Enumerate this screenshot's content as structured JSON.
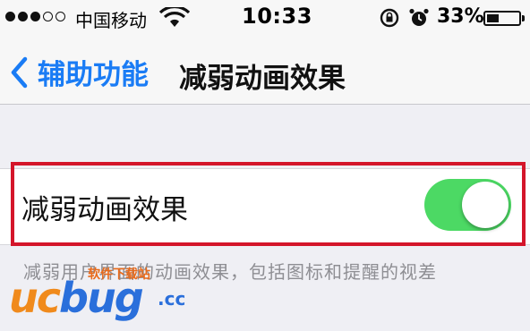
{
  "status_bar": {
    "carrier": "中国移动",
    "time": "10:33",
    "battery_percent": "33%",
    "battery_level": 0.33,
    "signal_bars_filled": 3,
    "signal_bars_total": 5
  },
  "nav": {
    "back_label": "辅助功能",
    "title": "减弱动画效果",
    "accent_color": "#1a7cf5"
  },
  "setting": {
    "label": "减弱动画效果",
    "toggle_on": true,
    "toggle_color": "#4cd964",
    "highlight_color": "#d4152a"
  },
  "footer": {
    "text": "减弱用户界面的动画效果，包括图标和提醒的视差"
  },
  "watermark": {
    "site_text": "软件下载站",
    "brand_prefix": "uc",
    "brand_main": "bug",
    "brand_suffix": ".cc"
  }
}
